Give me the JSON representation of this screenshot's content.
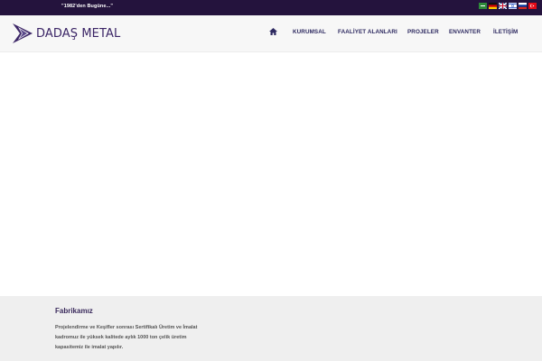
{
  "topbar": {
    "slogan": "\"1982'den Bugüne...\"",
    "languages": [
      "arabic-flag-icon",
      "german-flag-icon",
      "uk-flag-icon",
      "israel-flag-icon",
      "russia-flag-icon",
      "turkey-flag-icon"
    ]
  },
  "header": {
    "logo_text": "DADAŞ METAL",
    "nav": {
      "home_icon": "home-icon",
      "items": [
        "KURUMSAL",
        "FAALİYET ALANLARI",
        "PROJELER",
        "ENVANTER",
        "İLETİŞİM"
      ]
    }
  },
  "footer": {
    "title": "Fabrikamız",
    "text": "Projelendirme ve Keşifler sonrası Sertifikalı Üretim ve İmalat kadromuz ile yüksek kalitede aylık 1000 ton çelik üretim kapasitemiz ile imalat yapılır."
  },
  "colors": {
    "topbar": "#24133d",
    "nav_text": "#2d2960",
    "logo": "#3b2566",
    "footer_bg": "#efefef"
  }
}
